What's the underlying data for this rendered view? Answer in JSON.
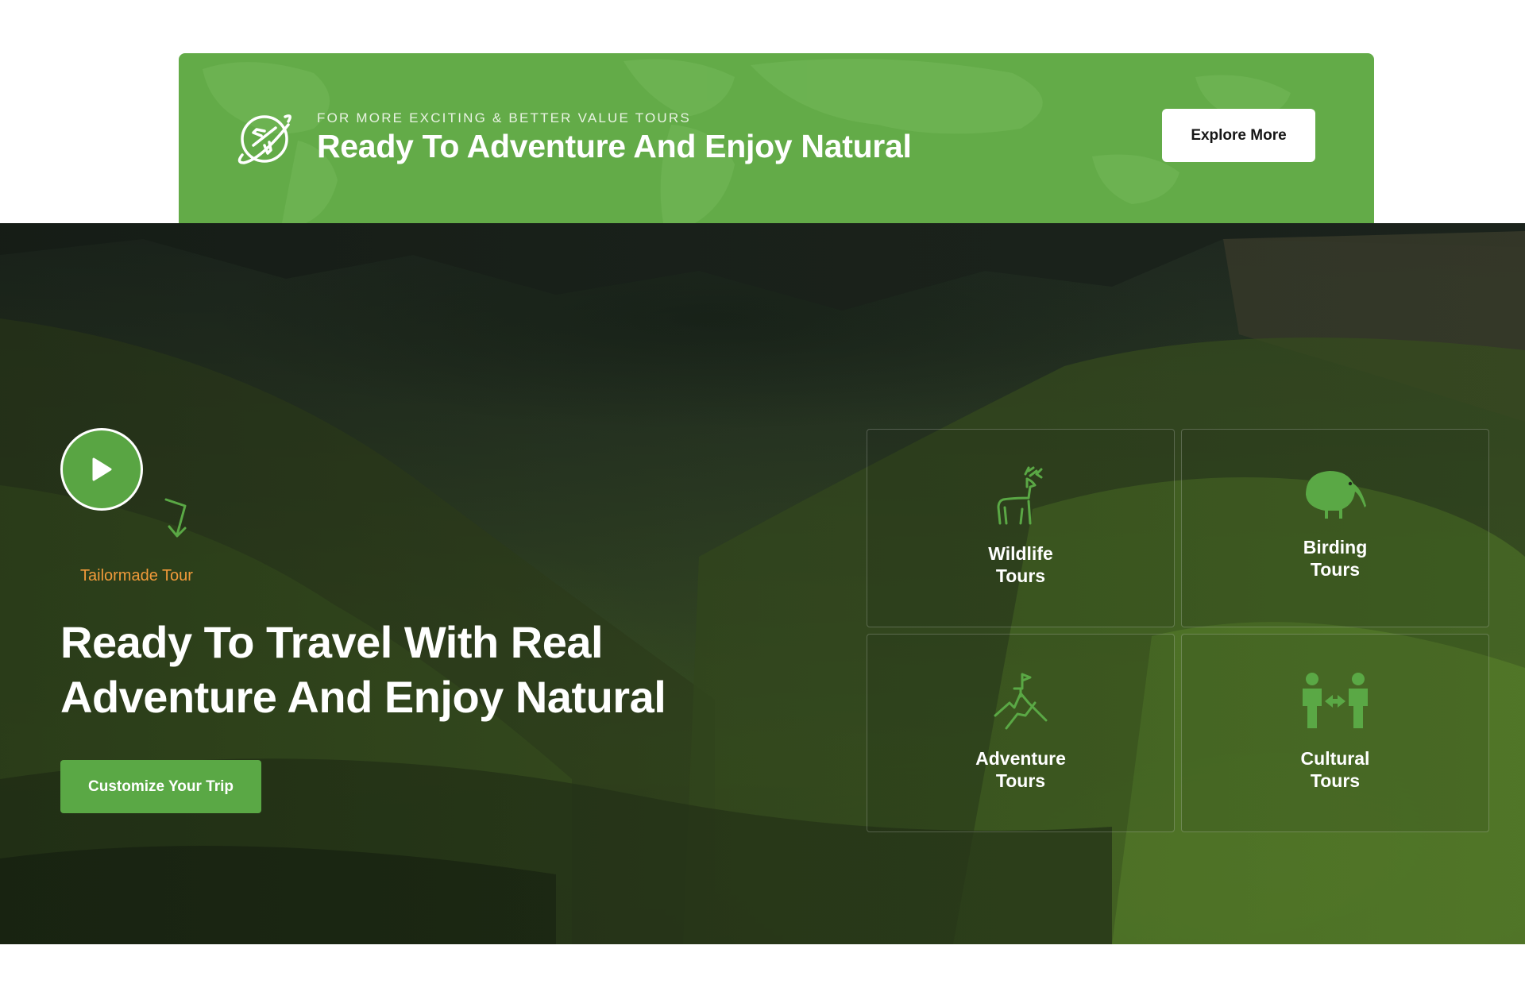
{
  "banner": {
    "kicker": "FOR MORE EXCITING & BETTER VALUE TOURS",
    "title": "Ready To Adventure And Enjoy Natural",
    "button_label": "Explore More",
    "icon": "plane-globe-icon"
  },
  "hero": {
    "tag_label": "Tailormade Tour",
    "title_line1": "Ready To Travel With Real",
    "title_line2": "Adventure And Enjoy Natural",
    "cta_label": "Customize Your Trip",
    "play_icon": "play-icon"
  },
  "tours": [
    {
      "line1": "Wildlife",
      "line2": "Tours",
      "icon": "deer-icon"
    },
    {
      "line1": "Birding",
      "line2": "Tours",
      "icon": "kiwi-bird-icon"
    },
    {
      "line1": "Adventure",
      "line2": "Tours",
      "icon": "mountain-climbing-icon"
    },
    {
      "line1": "Cultural",
      "line2": "Tours",
      "icon": "people-exchange-icon"
    }
  ],
  "colors": {
    "brand_green": "#63ab48",
    "accent_orange": "#f19a3a",
    "button_white": "#ffffff",
    "text_white": "#ffffff"
  }
}
